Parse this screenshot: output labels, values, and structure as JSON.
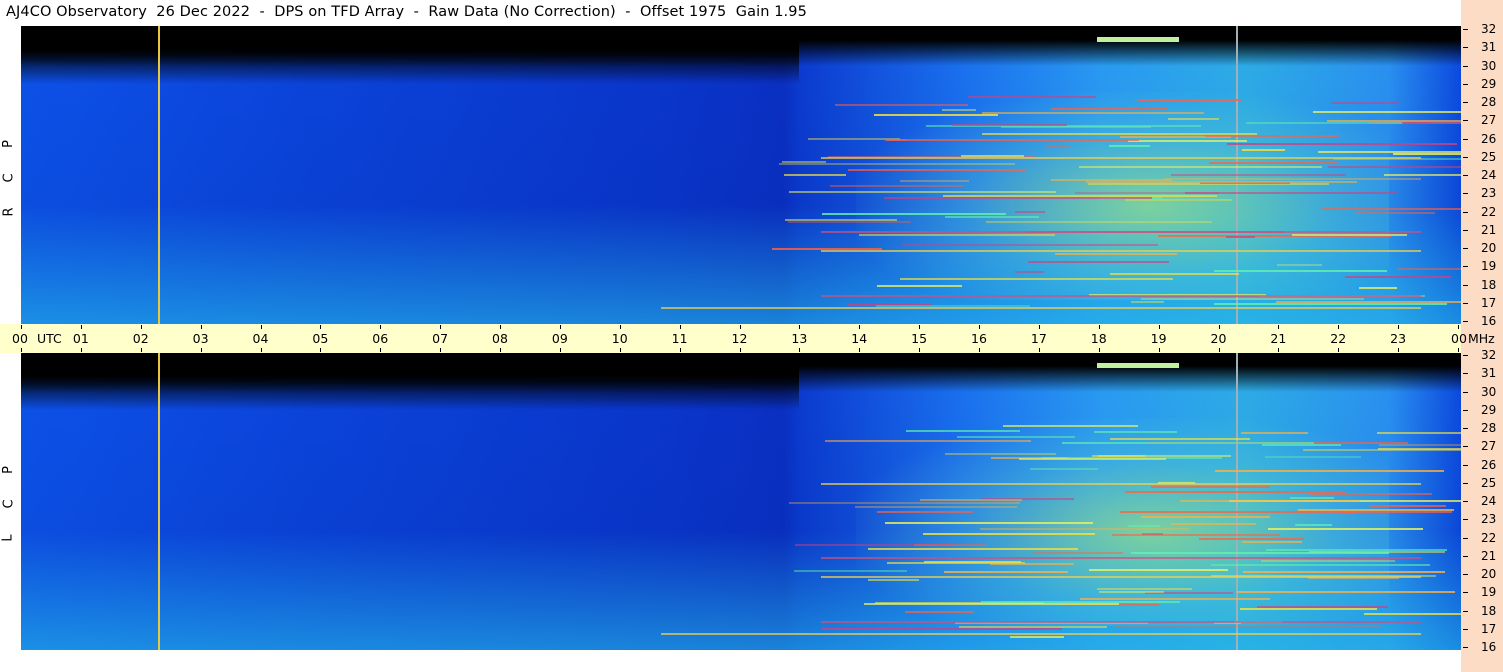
{
  "title": "AJ4CO Observatory  26 Dec 2022  -  DPS on TFD Array  -  Raw Data (No Correction)  -  Offset 1975  Gain 1.95",
  "colors": {
    "axis_band": "#ffffcc",
    "side_band": "#fcdcc4",
    "marker_line": "#e8c840"
  },
  "chart_data": [
    {
      "type": "heatmap",
      "polarization_label": [
        "R",
        "C",
        "P"
      ],
      "x": [
        "00",
        "01",
        "02",
        "03",
        "04",
        "05",
        "06",
        "07",
        "08",
        "09",
        "10",
        "11",
        "12",
        "13",
        "14",
        "15",
        "16",
        "17",
        "18",
        "19",
        "20",
        "21",
        "22",
        "23",
        "00"
      ],
      "y": [
        "32",
        "31",
        "30",
        "29",
        "28",
        "27",
        "26",
        "25",
        "24",
        "23",
        "22",
        "21",
        "20",
        "19",
        "18",
        "17",
        "16"
      ],
      "x_unit": "UTC",
      "y_unit": "MHz",
      "xlim": [
        0,
        24
      ],
      "ylim": [
        16,
        32
      ]
    },
    {
      "type": "heatmap",
      "polarization_label": [
        "L",
        "C",
        "P"
      ],
      "x": [
        "00",
        "01",
        "02",
        "03",
        "04",
        "05",
        "06",
        "07",
        "08",
        "09",
        "10",
        "11",
        "12",
        "13",
        "14",
        "15",
        "16",
        "17",
        "18",
        "19",
        "20",
        "21",
        "22",
        "23",
        "00"
      ],
      "y": [
        "32",
        "31",
        "30",
        "29",
        "28",
        "27",
        "26",
        "25",
        "24",
        "23",
        "22",
        "21",
        "20",
        "19",
        "18",
        "17",
        "16"
      ],
      "x_unit": "UTC",
      "y_unit": "MHz",
      "xlim": [
        0,
        24
      ],
      "ylim": [
        16,
        32
      ]
    }
  ]
}
